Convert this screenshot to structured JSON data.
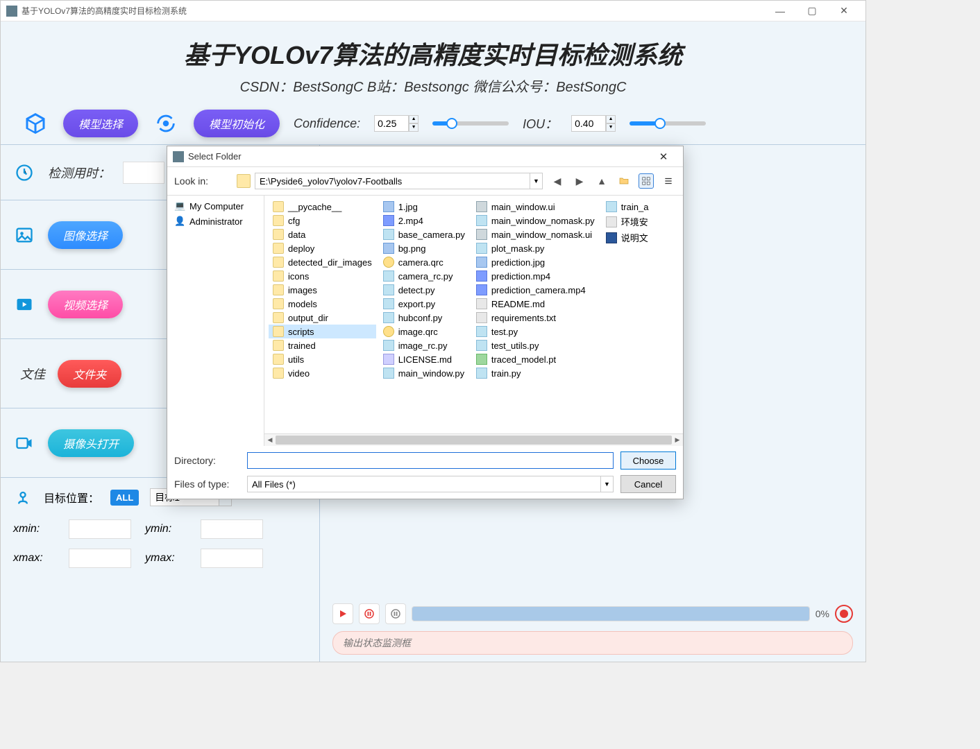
{
  "window": {
    "title": "基于YOLOv7算法的高精度实时目标检测系统",
    "minimize": "—",
    "maximize": "▢",
    "close": "✕"
  },
  "header": {
    "title": "基于YOLOv7算法的高精度实时目标检测系统",
    "subtitle": "CSDN：BestSongC    B站：Bestsongc    微信公众号：BestSongC"
  },
  "toolbar": {
    "model_select": "模型选择",
    "model_init": "模型初始化",
    "conf_label": "Confidence:",
    "conf_value": "0.25",
    "iou_label": "IOU：",
    "iou_value": "0.40"
  },
  "left": {
    "detect_time_label": "检测用时：",
    "image_select": "图像选择",
    "video_select": "视频选择",
    "folder_label": "文佳",
    "folder_button": "文件夹",
    "camera_open": "摄像头打开",
    "target_label": "目标位置：",
    "all_chip": "ALL",
    "target_select": "目标1",
    "xmin": "xmin:",
    "ymin": "ymin:",
    "xmax": "xmax:",
    "ymax": "ymax:"
  },
  "bottom": {
    "progress": "0%",
    "output_placeholder": "输出状态监测框"
  },
  "dialog": {
    "title": "Select Folder",
    "look_in": "Look in:",
    "path": "E:\\Pyside6_yolov7\\yolov7-Footballs",
    "tree": {
      "my_computer": "My Computer",
      "administrator": "Administrator"
    },
    "columns": {
      "col1": [
        {
          "name": "__pycache__",
          "kind": "folder"
        },
        {
          "name": "cfg",
          "kind": "folder"
        },
        {
          "name": "data",
          "kind": "folder"
        },
        {
          "name": "deploy",
          "kind": "folder"
        },
        {
          "name": "detected_dir_images",
          "kind": "folder"
        },
        {
          "name": "icons",
          "kind": "folder"
        },
        {
          "name": "images",
          "kind": "folder"
        },
        {
          "name": "models",
          "kind": "folder"
        },
        {
          "name": "output_dir",
          "kind": "folder"
        },
        {
          "name": "scripts",
          "kind": "folder",
          "selected": true
        },
        {
          "name": "trained",
          "kind": "folder"
        },
        {
          "name": "utils",
          "kind": "folder"
        },
        {
          "name": "video",
          "kind": "folder"
        }
      ],
      "col2": [
        {
          "name": "1.jpg",
          "kind": "img"
        },
        {
          "name": "2.mp4",
          "kind": "mp4"
        },
        {
          "name": "base_camera.py",
          "kind": "py"
        },
        {
          "name": "bg.png",
          "kind": "img"
        },
        {
          "name": "camera.qrc",
          "kind": "qrc"
        },
        {
          "name": "camera_rc.py",
          "kind": "py"
        },
        {
          "name": "detect.py",
          "kind": "py"
        },
        {
          "name": "export.py",
          "kind": "py"
        },
        {
          "name": "hubconf.py",
          "kind": "py"
        },
        {
          "name": "image.qrc",
          "kind": "qrc"
        },
        {
          "name": "image_rc.py",
          "kind": "py"
        },
        {
          "name": "LICENSE.md",
          "kind": "md"
        },
        {
          "name": "main_window.py",
          "kind": "py"
        }
      ],
      "col3": [
        {
          "name": "main_window.ui",
          "kind": "ui"
        },
        {
          "name": "main_window_nomask.py",
          "kind": "py"
        },
        {
          "name": "main_window_nomask.ui",
          "kind": "ui"
        },
        {
          "name": "plot_mask.py",
          "kind": "py"
        },
        {
          "name": "prediction.jpg",
          "kind": "img"
        },
        {
          "name": "prediction.mp4",
          "kind": "mp4"
        },
        {
          "name": "prediction_camera.mp4",
          "kind": "mp4"
        },
        {
          "name": "README.md",
          "kind": "txt"
        },
        {
          "name": "requirements.txt",
          "kind": "txt"
        },
        {
          "name": "test.py",
          "kind": "py"
        },
        {
          "name": "test_utils.py",
          "kind": "py"
        },
        {
          "name": "traced_model.pt",
          "kind": "pt"
        },
        {
          "name": "train.py",
          "kind": "py"
        }
      ],
      "col4": [
        {
          "name": "train_a",
          "kind": "py"
        },
        {
          "name": "环境安",
          "kind": "txt"
        },
        {
          "name": "说明文",
          "kind": "docx"
        }
      ]
    },
    "directory_label": "Directory:",
    "directory_value": "",
    "filetype_label": "Files of type:",
    "filetype_value": "All Files (*)",
    "choose": "Choose",
    "cancel": "Cancel"
  }
}
